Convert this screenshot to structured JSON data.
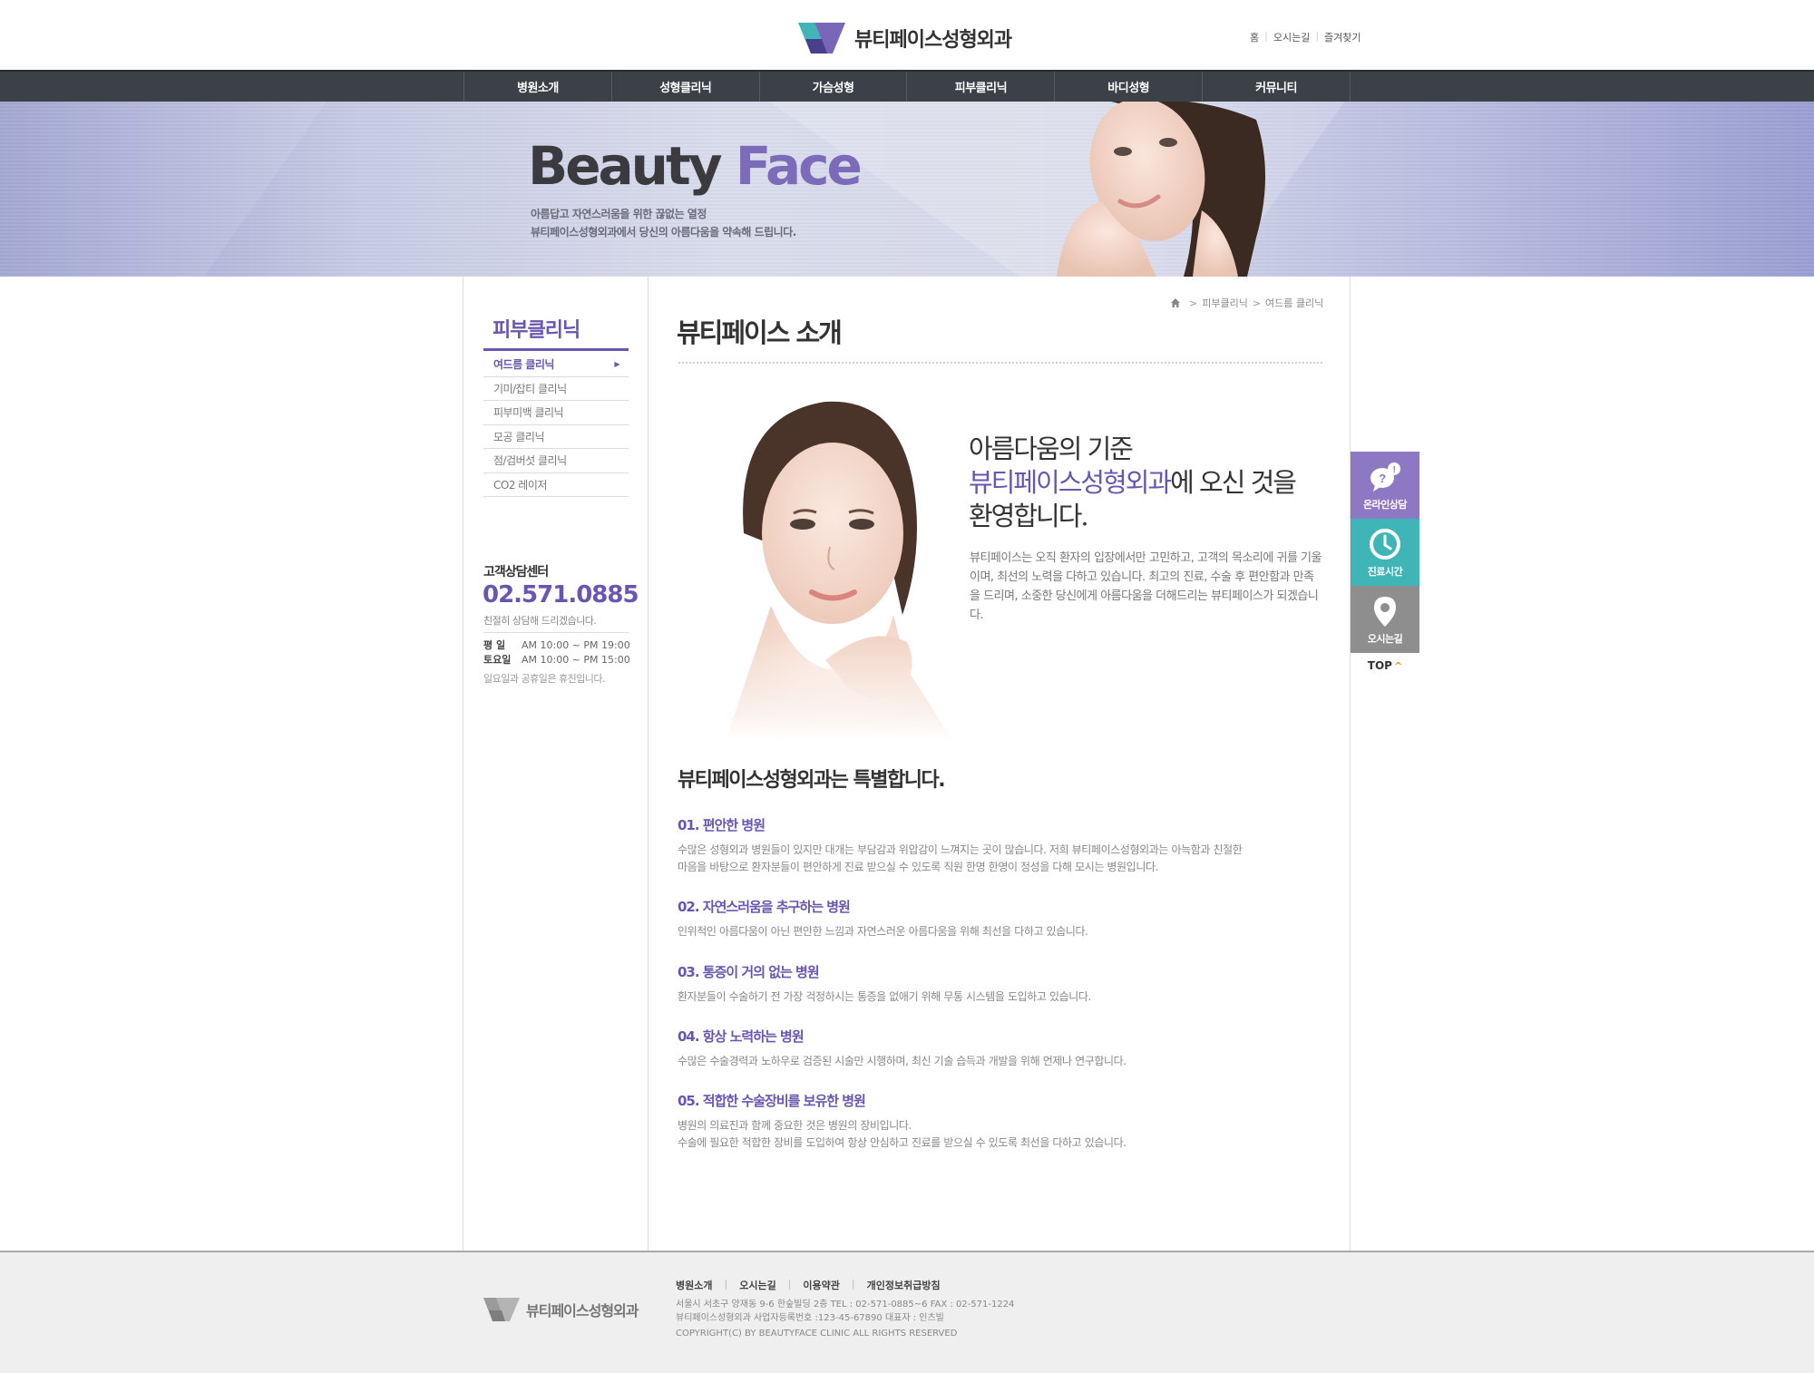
{
  "header": {
    "logo_text": "뷰티페이스성형외과",
    "util_links": [
      "홈",
      "오시는길",
      "즐겨찾기"
    ]
  },
  "gnb": {
    "items": [
      "병원소개",
      "성형클리닉",
      "가슴성형",
      "피부클리닉",
      "바디성형",
      "커뮤니티"
    ]
  },
  "visual": {
    "title_part1": "Beauty",
    "title_part2": "Face",
    "sub_line1": "아름답고 자연스러움을 위한 끊없는 열정",
    "sub_line2": "뷰티페이스성형외과에서 당신의 아름다움을 약속해 드립니다."
  },
  "sidebar": {
    "title": "피부클리닉",
    "items": [
      {
        "label": "여드름 클리닉",
        "active": true
      },
      {
        "label": "기미/잡티 클리닉",
        "active": false
      },
      {
        "label": "피부미백 클리닉",
        "active": false
      },
      {
        "label": "모공 클리닉",
        "active": false
      },
      {
        "label": "점/검버섯 클리닉",
        "active": false
      },
      {
        "label": "CO2 레이저",
        "active": false
      }
    ],
    "cs": {
      "title": "고객상담센터",
      "phone": "02.571.0885",
      "note": "친절히 상담해 드리겠습니다.",
      "weekday_label": "평  일",
      "weekday_hours": "AM 10:00 ~ PM 19:00",
      "saturday_label": "토요일",
      "saturday_hours": "AM 10:00 ~ PM 15:00",
      "holiday_note": "일요일과 공휴일은 휴진입니다."
    }
  },
  "breadcrumb": {
    "items": [
      "피부클리닉",
      "여드름 클리닉"
    ]
  },
  "main": {
    "page_title": "뷰티페이스 소개",
    "welcome_line1": "아름다움의 기준",
    "welcome_highlight": "뷰티페이스성형외과",
    "welcome_line2_rest": "에 오신 것을",
    "welcome_line3": "환영합니다.",
    "welcome_body": "뷰티페이스는 오직 환자의 입장에서만 고민하고, 고객의 목소리에 귀를 기울이며, 최선의 노력을 다하고 있습니다.  최고의 진료, 수술 후 편안함과 만족을 드리며, 소중한 당신에게 아름다움을 더해드리는 뷰티페이스가 되겠습니다.",
    "special_title": "뷰티페이스성형외과는 특별합니다.",
    "features": [
      {
        "title": "01. 편안한 병원",
        "desc1": "수많은 성형외과 병원들이 있지만 대개는 부담감과 위압감이 느껴지는 곳이 많습니다. 저희 뷰티페이스성형외과는 아늑함과 친절한",
        "desc2": "마음을 바탕으로 환자분들이 편안하게 진료 받으실 수 있도록 직원 한명 한명이 정성을 다해 모시는 병원입니다."
      },
      {
        "title": "02. 자연스러움을 추구하는 병원",
        "desc1": "인위적인 아름다움이 아닌 편안한 느낌과 자연스러운 아름다움을 위해 최선을 다하고 있습니다.",
        "desc2": ""
      },
      {
        "title": "03. 통증이 거의 없는 병원",
        "desc1": "환자분들이 수술하기 전 가장 걱정하시는 통증을 없애기 위해 무통 시스템을 도입하고 있습니다.",
        "desc2": ""
      },
      {
        "title": "04. 항상 노력하는 병원",
        "desc1": "수많은 수술경력과 노하우로 검증된 시술만 시행하며, 최신 기술 습득과 개발을 위해 언제나 연구합니다.",
        "desc2": ""
      },
      {
        "title": "05. 적합한 수술장비를 보유한 병원",
        "desc1": "병원의 의료진과 함께 중요한 것은 병원의 장비입니다.",
        "desc2": "수술에 필요한 적합한 장비를 도입하여 항상 안심하고 진료를 받으실 수 있도록 최선을 다하고 있습니다."
      }
    ]
  },
  "quick": {
    "items": [
      "온라인상담",
      "진료시간",
      "오시는길"
    ],
    "top_label": "TOP"
  },
  "footer": {
    "logo_text": "뷰티페이스성형외과",
    "links": [
      "병원소개",
      "오시는길",
      "이용약관",
      "개인정보취급방침"
    ],
    "address": "서울시 서초구 양재동 9-6  한숲빌딩 2층  TEL : 02-571-0885~6  FAX : 02-571-1224",
    "business": "뷰티페이스성형외과  사업자등록번호 :123-45-67890  대표자 : 인츠빌",
    "copyright": "COPYRIGHT(C) BY BEAUTYFACE CLINIC ALL RIGHTS RESERVED"
  },
  "colors": {
    "brand_purple": "#6a55b0",
    "gnb_bg": "#3c4047",
    "quick_consult": "#8d78c4",
    "quick_hours": "#3fb5b8",
    "quick_map": "#8e8e8e"
  }
}
